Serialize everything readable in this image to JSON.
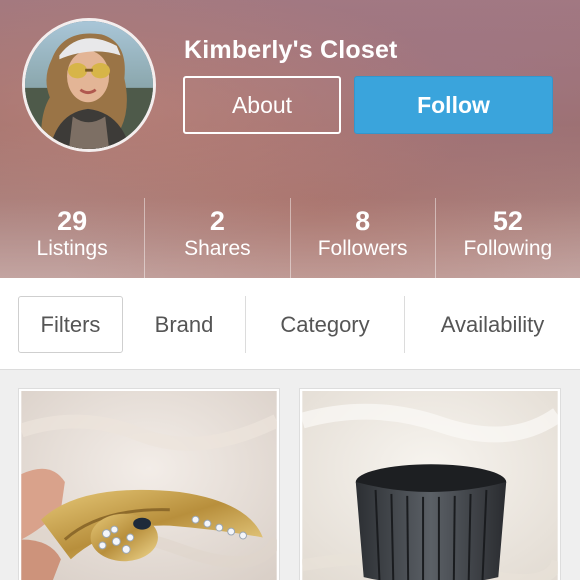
{
  "profile": {
    "name": "Kimberly's Closet",
    "about_label": "About",
    "follow_label": "Follow"
  },
  "stats": [
    {
      "value": "29",
      "label": "Listings"
    },
    {
      "value": "2",
      "label": "Shares"
    },
    {
      "value": "8",
      "label": "Followers"
    },
    {
      "value": "52",
      "label": "Following"
    }
  ],
  "filters": {
    "filters_label": "Filters",
    "brand_label": "Brand",
    "category_label": "Category",
    "availability_label": "Availability"
  },
  "colors": {
    "follow_button": "#3aa4dc",
    "header_tint": "#9c6e6a"
  },
  "listings": [
    {
      "image": "gold-snake-bracelet-photo"
    },
    {
      "image": "dark-metal-cuff-bracelet-photo"
    }
  ]
}
